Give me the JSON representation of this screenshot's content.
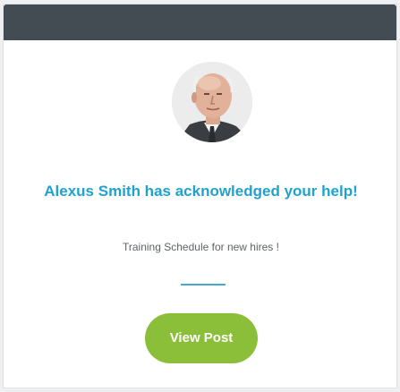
{
  "notification": {
    "headline": "Alexus Smith has acknowledged your help!",
    "post_title": "Training Schedule for new hires !",
    "button_label": "View Post"
  },
  "colors": {
    "header": "#434b53",
    "headline": "#1ea3cf",
    "divider": "#47a7cd",
    "button": "#8bbf3a"
  },
  "avatar": {
    "icon": "user-avatar-photo"
  }
}
